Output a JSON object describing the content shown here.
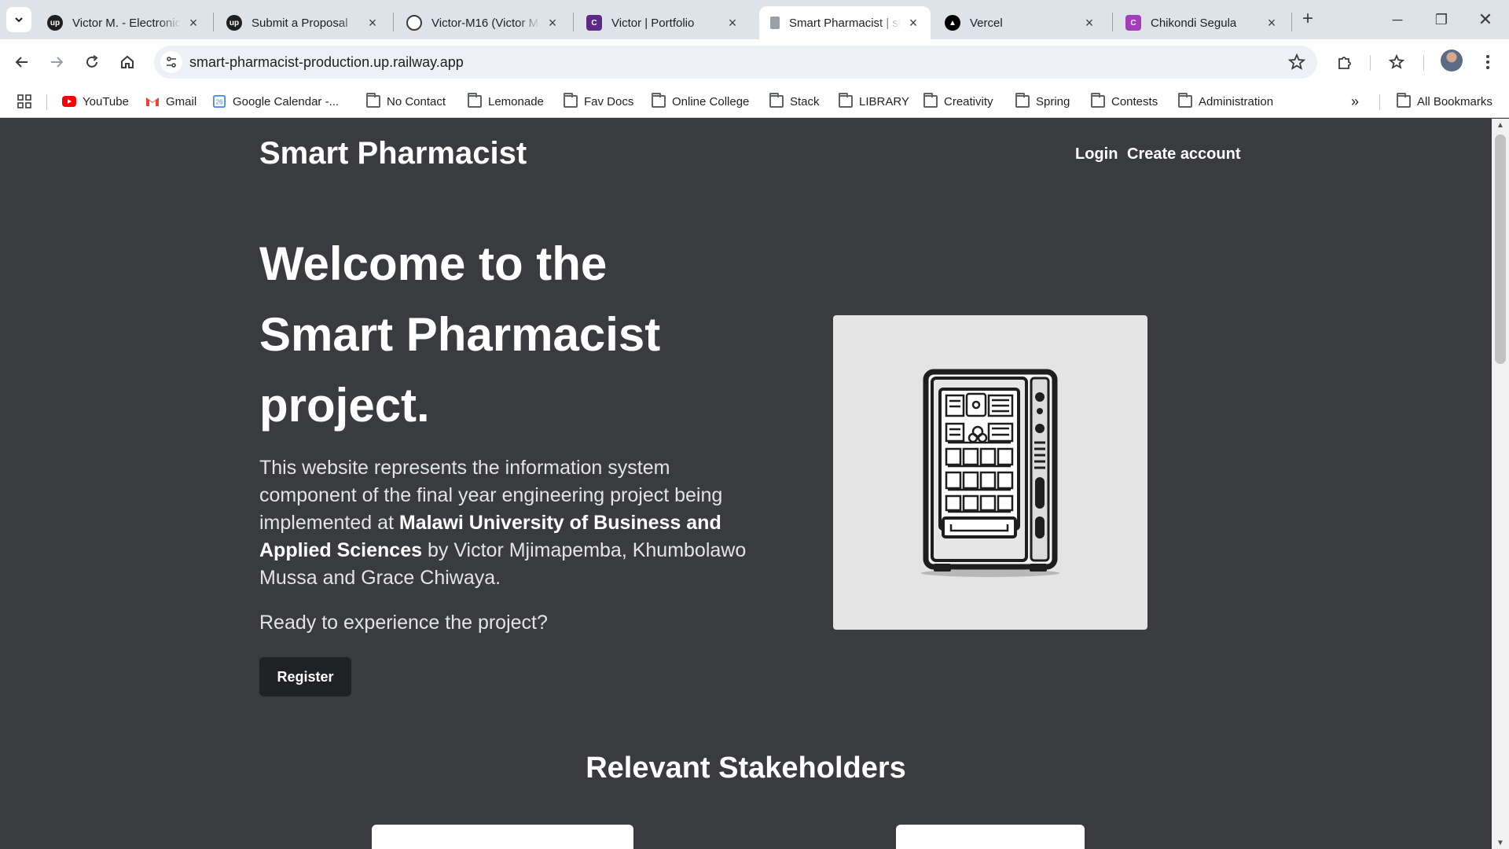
{
  "browser": {
    "tabs": [
      {
        "title": "Victor M. - Electronic",
        "favicon": "upwork-icon",
        "active": false
      },
      {
        "title": "Submit a Proposal",
        "favicon": "upwork-icon",
        "active": false
      },
      {
        "title": "Victor-M16 (Victor M",
        "favicon": "github-icon",
        "active": false
      },
      {
        "title": "Victor | Portfolio",
        "favicon": "portfolio-icon",
        "active": false
      },
      {
        "title": "Smart Pharmacist | sr",
        "favicon": "page-icon",
        "active": true
      },
      {
        "title": "Vercel",
        "favicon": "vercel-icon",
        "active": false
      },
      {
        "title": "Chikondi Segula",
        "favicon": "canva-icon",
        "active": false
      }
    ],
    "url": "smart-pharmacist-production.up.railway.app",
    "bookmarks": {
      "youtube": "YouTube",
      "gmail": "Gmail",
      "calendar": "Google Calendar -...",
      "folders": [
        "No Contact",
        "Lemonade",
        "Fav Docs",
        "Online College",
        "Stack",
        "LIBRARY",
        "Creativity",
        "Spring",
        "Contests",
        "Administration"
      ],
      "all_bookmarks": "All Bookmarks"
    }
  },
  "site": {
    "brand": "Smart Pharmacist",
    "nav": {
      "login": "Login",
      "create_account": "Create account"
    },
    "hero": {
      "title": "Welcome to the Smart Pharmacist project.",
      "desc_before": "This website represents the information system component of the final year engineering project being implemented at ",
      "desc_bold": "Malawi University of Business and Applied Sciences",
      "desc_after": " by Victor Mjimapemba, Khumbolawo Mussa and Grace Chiwaya.",
      "cta_text": "Ready to experience the project?",
      "register_label": "Register",
      "image_alt": "medicine-vending-machine-illustration"
    },
    "stakeholders_title": "Relevant Stakeholders"
  },
  "colors": {
    "page_bg": "#3a3b3f",
    "tabbar_bg": "#dee3ea",
    "button_bg": "#202124",
    "text": "#ffffff"
  }
}
